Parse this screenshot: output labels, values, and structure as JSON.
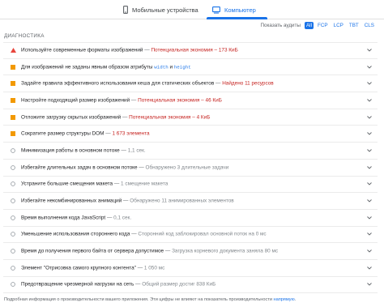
{
  "tabs": {
    "mobile": "Мобильные устройства",
    "desktop": "Компьютер"
  },
  "filter": {
    "label": "Показать аудиты",
    "options": [
      "All",
      "FCP",
      "LCP",
      "TBT",
      "CLS"
    ],
    "selected": "All"
  },
  "section_title": "ДИАГНОСТИКА",
  "audits": [
    {
      "status": "fail",
      "title": "Используйте современные форматы изображений",
      "sep": " — ",
      "detail": "Потенциальная экономия – 173 КиБ"
    },
    {
      "status": "average",
      "title": "Для изображений не заданы явным образом атрибуты ",
      "code1": "width",
      "and": " и ",
      "code2": "height"
    },
    {
      "status": "average",
      "title": "Задайте правила эффективного использования кеша для статических объектов",
      "sep": " — ",
      "detail": "Найдено 11 ресурсов"
    },
    {
      "status": "average",
      "title": "Настройте подходящий размер изображений",
      "sep": " — ",
      "detail": "Потенциальная экономия – 46 КиБ"
    },
    {
      "status": "average",
      "title": "Отложите загрузку скрытых изображений",
      "sep": " — ",
      "detail": "Потенциальная экономия – 4 КиБ"
    },
    {
      "status": "average",
      "title": "Сократите размер структуры DOM",
      "sep": " — ",
      "detail": "1 673 элемента"
    },
    {
      "status": "info",
      "title": "Минимизация работы в основном потоке",
      "sep": " — ",
      "detail": "1,1 сек."
    },
    {
      "status": "info",
      "title": "Избегайте длительных задач в основном потоке",
      "sep": " — ",
      "detail": "Обнаружено 3 длительные задачи"
    },
    {
      "status": "info",
      "title": "Устраните большие смещения макета",
      "sep": " — ",
      "detail": "1 смещение макета"
    },
    {
      "status": "info",
      "title": "Избегайте некомбинированных анимаций",
      "sep": " — ",
      "detail": "Обнаружено 11 анимированных элементов"
    },
    {
      "status": "info",
      "title": "Время выполнения кода JavaScript",
      "sep": " — ",
      "detail": "0,1 сек."
    },
    {
      "status": "info",
      "title": "Уменьшение использования стороннего кода",
      "sep": " — ",
      "detail": "Сторонний код заблокировал основной поток на 0 мс"
    },
    {
      "status": "info",
      "title": "Время до получения первого байта от сервера допустимое",
      "sep": " — ",
      "detail": "Загрузка корневого документа заняла 80 мс"
    },
    {
      "status": "info",
      "title": "Элемент \"Отрисовка самого крупного контента\"",
      "sep": " — ",
      "detail": "1 050 мс"
    },
    {
      "status": "info",
      "title": "Предотвращение чрезмерной нагрузки на сеть",
      "sep": " — ",
      "detail": "Общий размер достиг 838 КиБ"
    }
  ],
  "footer": {
    "text": "Подробная информация о производительности вашего приложения. Эти цифры не влияют на показатель производительности ",
    "link": "напрямую",
    "end": "."
  },
  "colors": {
    "accent": "#1a73e8",
    "fail": "#e8453c",
    "average": "#f29900",
    "info_outline": "#9aa0a6"
  }
}
